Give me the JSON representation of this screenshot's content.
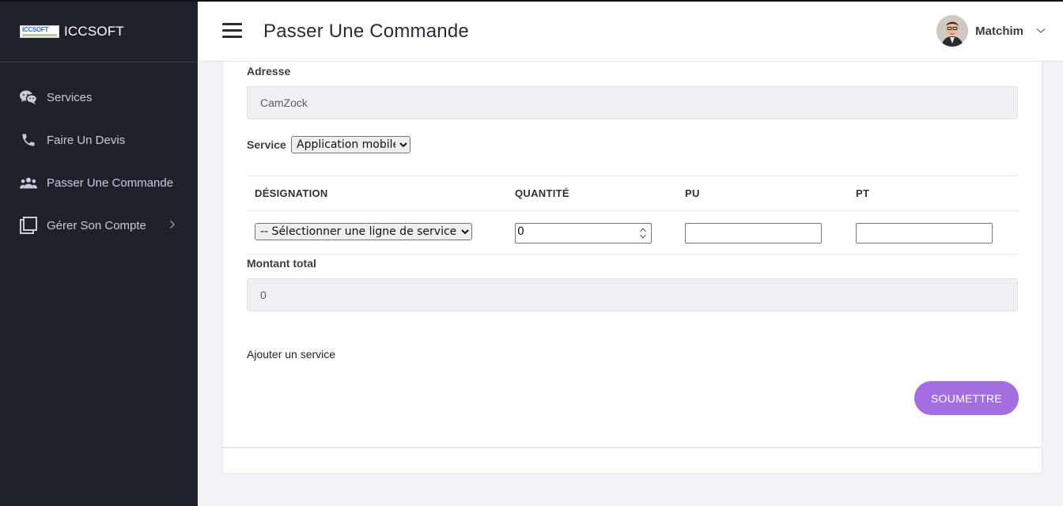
{
  "brand": {
    "logo_text": "ICCSOFT",
    "name": "ICCSOFT"
  },
  "sidebar": {
    "items": [
      {
        "label": "Services",
        "icon": "chat-bubbles-icon"
      },
      {
        "label": "Faire Un Devis",
        "icon": "phone-icon"
      },
      {
        "label": "Passer Une Commande",
        "icon": "users-icon"
      },
      {
        "label": "Gérer Son Compte",
        "icon": "copy-squares-icon",
        "has_submenu": true
      }
    ]
  },
  "header": {
    "title": "Passer Une Commande",
    "user_name": "Matchim"
  },
  "form": {
    "address_label": "Adresse",
    "address_value": "CamZock",
    "service_label": "Service",
    "service_selected": "Application mobile",
    "columns": [
      "DÉSIGNATION",
      "QUANTITÉ",
      "PU",
      "PT"
    ],
    "row": {
      "designation_selected": "-- Sélectionner une ligne de service --",
      "quantity": "0",
      "pu": "",
      "pt": ""
    },
    "total_label": "Montant total",
    "total_value": "0",
    "add_service_label": "Ajouter un service",
    "submit_label": "SOUMETTRE"
  },
  "colors": {
    "sidebar_bg": "#1f212b",
    "accent": "#a26ee0",
    "page_bg": "#f1f2f6"
  }
}
